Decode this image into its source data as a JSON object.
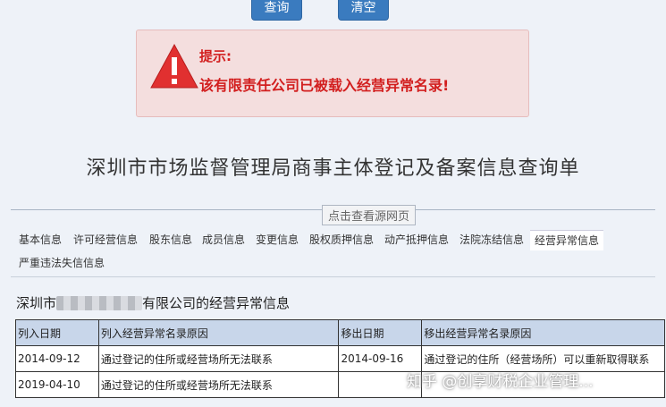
{
  "buttons": {
    "query": "查询",
    "clear": "清空"
  },
  "alert": {
    "title": "提示:",
    "message": "该有限责任公司已被载入经营异常名录!"
  },
  "page_title": "深圳市市场监督管理局商事主体登记及备案信息查询单",
  "source_link": "点击查看源网页",
  "tabs": [
    "基本信息",
    "许可经营信息",
    "股东信息",
    "成员信息",
    "变更信息",
    "股权质押信息",
    "动产抵押信息",
    "法院冻结信息",
    "经营异常信息",
    "严重违法失信信息"
  ],
  "active_tab": "经营异常信息",
  "section": {
    "prefix": "深圳市",
    "suffix": "有限公司的经营异常信息"
  },
  "table": {
    "headers": [
      "列入日期",
      "列入经营异常名录原因",
      "移出日期",
      "移出经营异常名录原因"
    ],
    "rows": [
      [
        "2014-09-12",
        "通过登记的住所或经营场所无法联系",
        "2014-09-16",
        "通过登记的住所（经营场所）可以重新取得联系"
      ],
      [
        "2019-04-10",
        "通过登记的住所或经营场所无法联系",
        "",
        ""
      ]
    ]
  },
  "watermark": "知乎 @创享财税企业管理..."
}
